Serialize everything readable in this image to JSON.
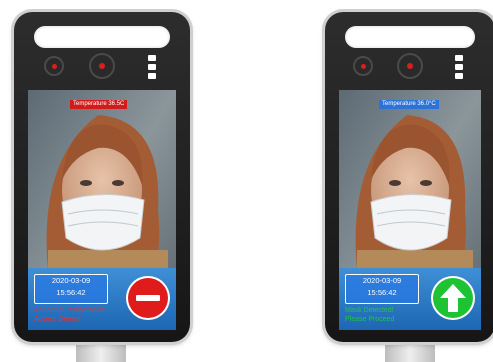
{
  "left": {
    "temperature_label": "Temperature 36.5C",
    "temperature_color": "#d21b1b",
    "date": "2020-03-09",
    "time": "15:56:42",
    "status_line1": "Abnormal Temperature",
    "status_line2": "Access Denied",
    "status_color": "#e53535",
    "sign_icon": "stop-sign-icon"
  },
  "right": {
    "temperature_label": "Temperature 36.0°C",
    "temperature_color": "#2b73d9",
    "date": "2020-03-09",
    "time": "15:56:42",
    "status_line1": "Mask Detected!",
    "status_line2": "Please Proceed",
    "status_color": "#22c742",
    "sign_icon": "up-arrow-icon"
  }
}
